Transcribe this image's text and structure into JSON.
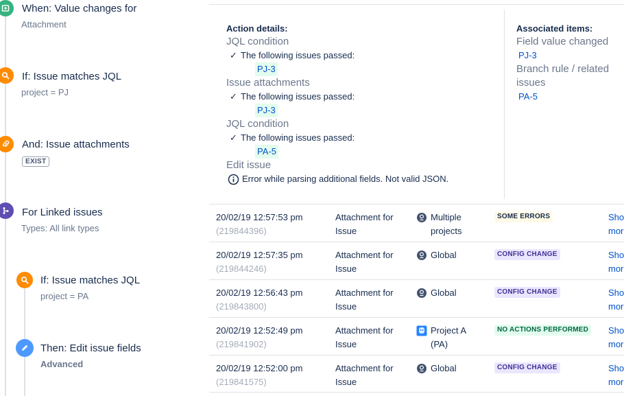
{
  "colors": {
    "trigger_green": "#36b37e",
    "condition_orange": "#ff8b00",
    "branch_purple": "#5e4db2",
    "action_blue": "#4c9aff",
    "link_blue": "#0052cc",
    "chip_green_bg": "#e3fcef"
  },
  "rule": {
    "trigger": {
      "icon": "trigger-icon",
      "title": "When: Value changes for",
      "sub": "Attachment"
    },
    "condition1": {
      "icon": "search-icon",
      "title": "If: Issue matches JQL",
      "sub": "project = PJ"
    },
    "condition2": {
      "icon": "paperclip-icon",
      "title": "And: Issue attachments",
      "badge": "EXIST"
    },
    "branch": {
      "icon": "branch-icon",
      "title": "For Linked issues",
      "sub": "Types: All link types"
    },
    "branch_condition": {
      "icon": "search-icon",
      "title": "If: Issue matches JQL",
      "sub": "project = PA"
    },
    "branch_action": {
      "icon": "pencil-icon",
      "title": "Then: Edit issue fields",
      "sub": "Advanced"
    }
  },
  "details": {
    "heading": "Action details:",
    "items": [
      {
        "name": "JQL condition",
        "passed": "The following issues passed:",
        "issue": "PJ-3"
      },
      {
        "name": "Issue attachments",
        "passed": "The following issues passed:",
        "issue": "PJ-3"
      },
      {
        "name": "JQL condition",
        "passed": "The following issues passed:",
        "issue": "PA-5"
      }
    ],
    "edit": {
      "name": "Edit issue",
      "error": "Error while parsing additional fields. Not valid JSON."
    }
  },
  "associated": {
    "heading": "Associated items:",
    "groups": [
      {
        "name": "Field value changed",
        "link": "PJ-3"
      },
      {
        "name": "Branch rule / related issues",
        "link": "PA-5"
      }
    ]
  },
  "audit_rows": [
    {
      "date": "20/02/19 12:57:53 pm",
      "id": "(219844396)",
      "type": "Attachment for Issue",
      "scope_icon": "globe-icon",
      "scope": "Multiple projects",
      "status": "SOME ERRORS",
      "status_kind": "some",
      "more": "Show more"
    },
    {
      "date": "20/02/19 12:57:35 pm",
      "id": "(219844246)",
      "type": "Attachment for Issue",
      "scope_icon": "globe-icon",
      "scope": "Global",
      "status": "CONFIG CHANGE",
      "status_kind": "config",
      "more": "Show more"
    },
    {
      "date": "20/02/19 12:56:43 pm",
      "id": "(219843800)",
      "type": "Attachment for Issue",
      "scope_icon": "globe-icon",
      "scope": "Global",
      "status": "CONFIG CHANGE",
      "status_kind": "config",
      "more": "Show more"
    },
    {
      "date": "20/02/19 12:52:49 pm",
      "id": "(219841902)",
      "type": "Attachment for Issue",
      "scope_icon": "project-avatar-icon",
      "scope": "Project A (PA)",
      "status": "NO ACTIONS PERFORMED",
      "status_kind": "none",
      "more": "Show more"
    },
    {
      "date": "20/02/19 12:52:00 pm",
      "id": "(219841575)",
      "type": "Attachment for Issue",
      "scope_icon": "globe-icon",
      "scope": "Global",
      "status": "CONFIG CHANGE",
      "status_kind": "config",
      "more": "Show more"
    }
  ]
}
